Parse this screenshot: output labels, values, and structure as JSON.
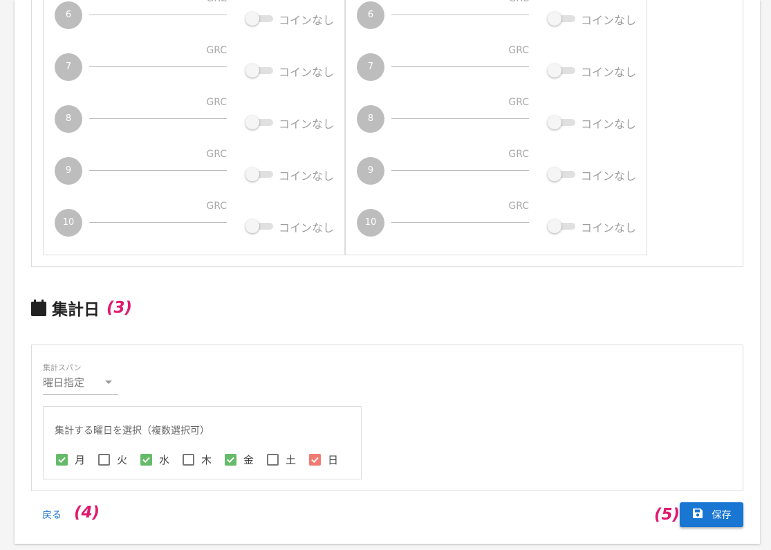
{
  "rank_columns": [
    {
      "rows": [
        {
          "rank": "6",
          "unit": "GRC",
          "switch_label": "コインなし"
        },
        {
          "rank": "7",
          "unit": "GRC",
          "switch_label": "コインなし"
        },
        {
          "rank": "8",
          "unit": "GRC",
          "switch_label": "コインなし"
        },
        {
          "rank": "9",
          "unit": "GRC",
          "switch_label": "コインなし"
        },
        {
          "rank": "10",
          "unit": "GRC",
          "switch_label": "コインなし"
        }
      ]
    },
    {
      "rows": [
        {
          "rank": "6",
          "unit": "GRC",
          "switch_label": "コインなし"
        },
        {
          "rank": "7",
          "unit": "GRC",
          "switch_label": "コインなし"
        },
        {
          "rank": "8",
          "unit": "GRC",
          "switch_label": "コインなし"
        },
        {
          "rank": "9",
          "unit": "GRC",
          "switch_label": "コインなし"
        },
        {
          "rank": "10",
          "unit": "GRC",
          "switch_label": "コインなし"
        }
      ]
    }
  ],
  "aggregation": {
    "heading": "集計日",
    "heading_marker": "(3)",
    "span_label": "集計スパン",
    "span_value": "曜日指定",
    "days_title": "集計する曜日を選択（複数選択可）",
    "days": [
      {
        "label": "月",
        "checked": true,
        "color": "#66bb6a"
      },
      {
        "label": "火",
        "checked": false,
        "color": "#777777"
      },
      {
        "label": "水",
        "checked": true,
        "color": "#66bb6a"
      },
      {
        "label": "木",
        "checked": false,
        "color": "#777777"
      },
      {
        "label": "金",
        "checked": true,
        "color": "#66bb6a"
      },
      {
        "label": "土",
        "checked": false,
        "color": "#777777"
      },
      {
        "label": "日",
        "checked": true,
        "color": "#ef7b72"
      }
    ]
  },
  "footer": {
    "back_label": "戻る",
    "back_marker": "(4)",
    "save_marker": "(5)",
    "save_label": "保存",
    "save_color": "#1976d2"
  }
}
